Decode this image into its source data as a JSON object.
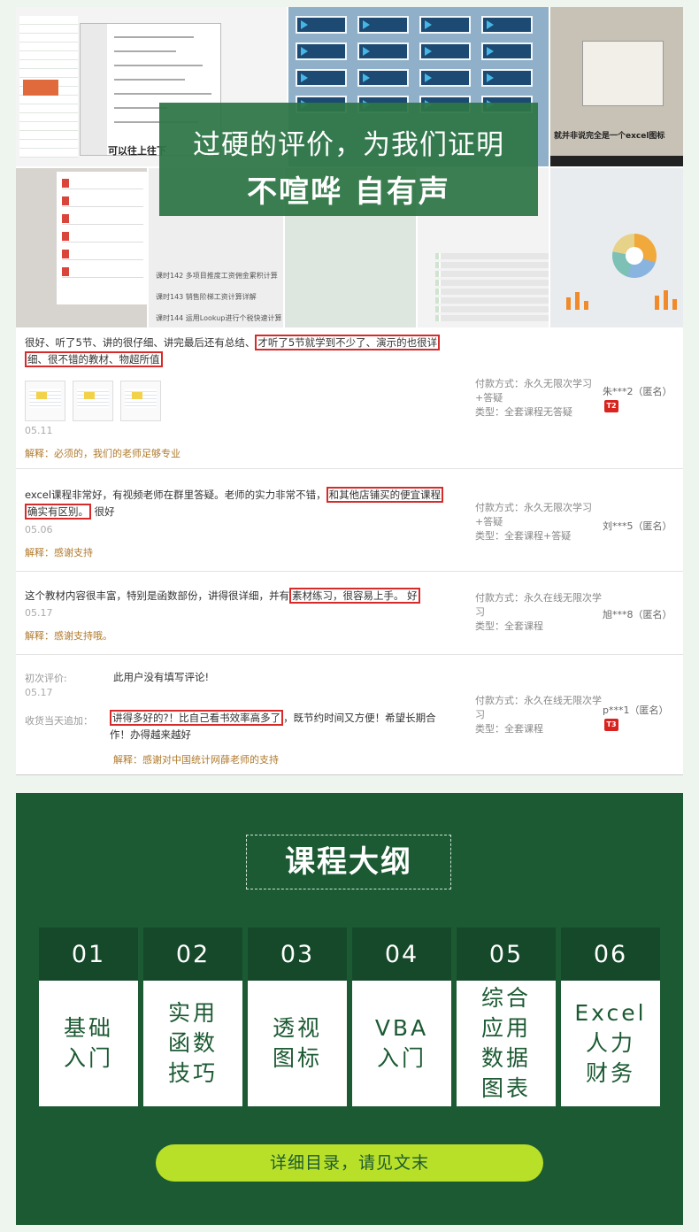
{
  "collage": {
    "excel_caption": "可以往上往下",
    "monitor_caption": "就并非说完全是一个excel图标",
    "laptop_items": [
      "课时142  多项目推度工资佣金累积计算",
      "课时143  销售阶梯工资计算详解",
      "课时144  运用Lookup进行个税快速计算"
    ],
    "overlay_line1": "过硬的评价，为我们证明",
    "overlay_line2": "不喧哗 自有声"
  },
  "reviews": [
    {
      "text_pre": "很好、听了5节、讲的很仔细、讲完最后还有总结、",
      "highlight1": "才听了5节就学到不少了、演示的也很详",
      "highlight2": "细、很不错的教材、物超所值",
      "text_post": "",
      "date": "05.11",
      "reply": "解释：必须的，我们的老师足够专业",
      "pay_label": "付款方式：永久无限次学习+答疑",
      "type_label": "类型：全套课程无答疑",
      "user": "朱***2（匿名）",
      "badge": "T2"
    },
    {
      "text_pre": "excel课程非常好，有视频老师在群里答疑。老师的实力非常不错，",
      "highlight1": "和其他店铺买的便宜课程",
      "highlight2": "确实有区别。",
      "text_post": "很好",
      "date": "05.06",
      "reply": "解释：感谢支持",
      "pay_label": "付款方式：永久无限次学习+答疑",
      "type_label": "类型：全套课程+答疑",
      "user": "刘***5（匿名）",
      "badge": ""
    },
    {
      "text_pre": "这个教材内容很丰富，特别是函数部份，讲得很详细，并有",
      "highlight1": "素材练习，很容易上手。 好",
      "highlight2": "",
      "text_post": "",
      "date": "05.17",
      "reply": "解释：感谢支持哦。",
      "pay_label": "付款方式：永久在线无限次学习",
      "type_label": "类型：全套课程",
      "user": "旭***8（匿名）",
      "badge": ""
    },
    {
      "first_label": "初次评价:",
      "first_text": "此用户没有填写评论!",
      "date": "05.17",
      "append_label": "收货当天追加：",
      "highlight1": "讲得多好的?！比自己看书效率高多了",
      "text_post": "，既节约时间又方便！希望长期合作！办得越来越好",
      "reply": "解释：感谢对中国统计网薛老师的支持",
      "pay_label": "付款方式：永久在线无限次学习",
      "type_label": "类型：全套课程",
      "user": "p***1（匿名）",
      "badge": "T3"
    }
  ],
  "outline": {
    "title": "课程大纲",
    "cards": [
      {
        "num": "01",
        "label": "基础\n入门"
      },
      {
        "num": "02",
        "label": "实用\n函数\n技巧"
      },
      {
        "num": "03",
        "label": "透视\n图标"
      },
      {
        "num": "04",
        "label": "VBA\n入门"
      },
      {
        "num": "05",
        "label": "综合\n应用\n数据\n图表"
      },
      {
        "num": "06",
        "label": "Excel\n人力\n财务"
      }
    ],
    "cta": "详细目录，请见文末"
  },
  "colors": {
    "brand_green": "#1c5a33",
    "card_header": "#15492a",
    "highlight_red": "#d62b2b",
    "cta_lime": "#b9e028",
    "reply_brown": "#b07a2c"
  }
}
